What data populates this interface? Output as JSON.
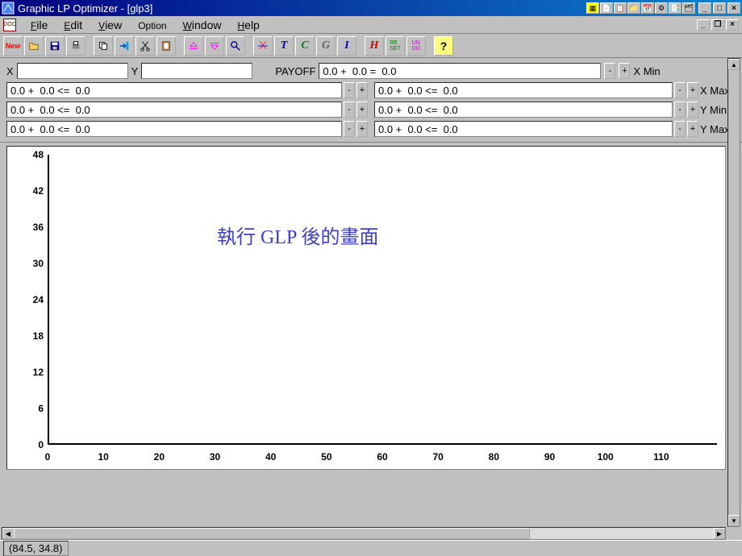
{
  "title": "Graphic LP Optimizer - [glp3]",
  "menu": {
    "file": "File",
    "edit": "Edit",
    "view": "View",
    "option": "Option",
    "window": "Window",
    "help": "Help"
  },
  "toolbar": {
    "new": "New",
    "T": "T",
    "C": "C",
    "G": "G",
    "I": "I",
    "H": "H",
    "reset": "RE\nSET",
    "undo": "UN\nDO",
    "help": "?"
  },
  "form": {
    "x_label": "X",
    "x_value": "",
    "y_label": "Y",
    "y_value": "",
    "payoff_label": "PAYOFF",
    "payoff_value": "0.0 +  0.0 =  0.0",
    "minus": "-",
    "plus": "+",
    "xmin_label": "X Min",
    "xmax_label": "X Max",
    "ymin_label": "Y Min",
    "ymax_label": "Y Max",
    "constraints_left": [
      "0.0 +  0.0 <=  0.0",
      "0.0 +  0.0 <=  0.0",
      "0.0 +  0.0 <=  0.0"
    ],
    "constraints_right": [
      "0.0 +  0.0 <=  0.0",
      "0.0 +  0.0 <=  0.0",
      "0.0 +  0.0 <=  0.0"
    ]
  },
  "chart_data": {
    "type": "scatter",
    "title": "",
    "xlabel": "",
    "ylabel": "",
    "xlim": [
      0,
      120
    ],
    "ylim": [
      0,
      48
    ],
    "xticks": [
      0,
      10,
      20,
      30,
      40,
      50,
      60,
      70,
      80,
      90,
      100,
      110
    ],
    "yticks": [
      0,
      6,
      12,
      18,
      24,
      30,
      36,
      42,
      48
    ],
    "series": []
  },
  "overlay": "執行 GLP 後的畫面",
  "status": "(84.5, 34.8)"
}
